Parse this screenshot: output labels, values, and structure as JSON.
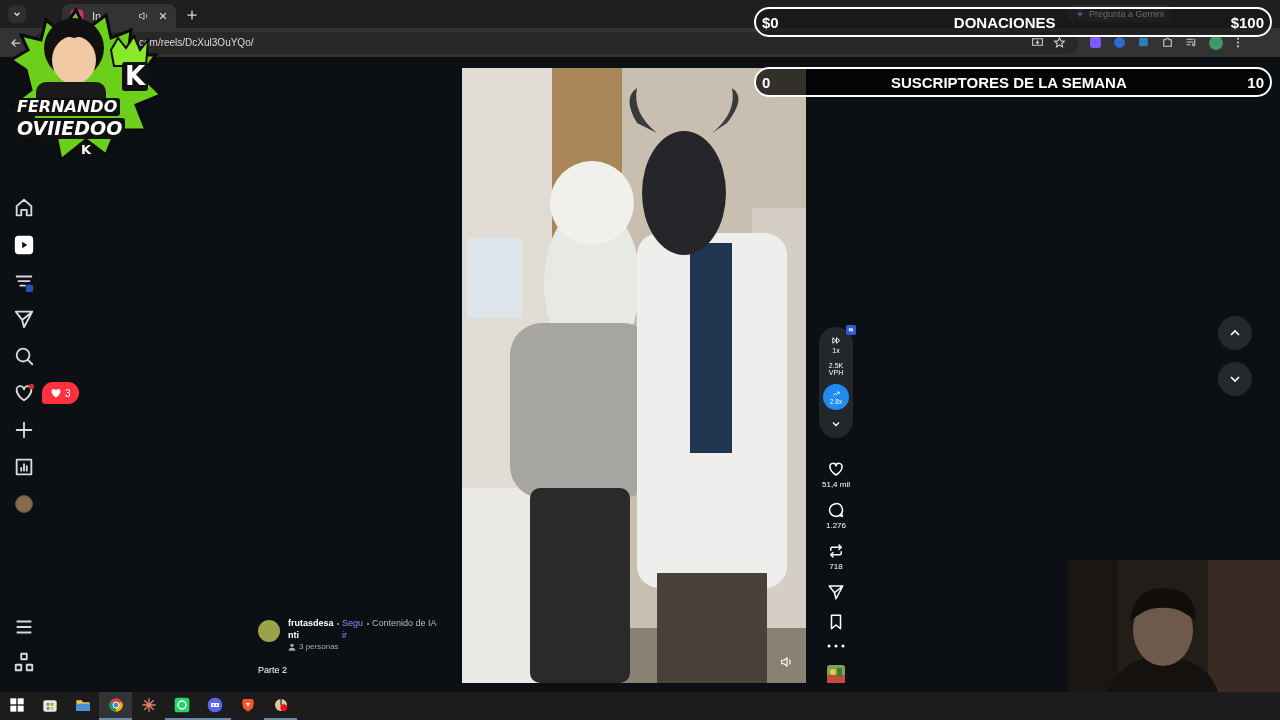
{
  "browser": {
    "tab": {
      "title": "In",
      "audio": true
    },
    "url": "com/reels/DcXul3OuYQo/",
    "gemini": "Pregunta a Gemini"
  },
  "overlay": {
    "logo": {
      "lines": [
        "FERNANDO",
        "OVIIEDOO"
      ],
      "marks": [
        "K",
        "K"
      ]
    },
    "goals": [
      {
        "label": "DONACIONES",
        "start": "$0",
        "end": "$100",
        "level": 0
      },
      {
        "label": "SUSCRIPTORES DE LA SEMANA",
        "start": "0",
        "end": "10",
        "level": 0
      }
    ]
  },
  "sidebar": {
    "items": [
      {
        "kind": "home",
        "selected": false,
        "dot": false
      },
      {
        "kind": "reels",
        "selected": true,
        "dot": false
      },
      {
        "kind": "feed",
        "selected": false,
        "dot": false
      },
      {
        "kind": "send",
        "selected": false,
        "dot": false
      },
      {
        "kind": "search",
        "selected": false,
        "dot": false
      },
      {
        "kind": "heart",
        "selected": false,
        "dot": true
      },
      {
        "kind": "plus",
        "selected": false,
        "dot": false
      },
      {
        "kind": "insights",
        "selected": false,
        "dot": false
      },
      {
        "kind": "avatar",
        "selected": false,
        "dot": false
      }
    ],
    "bottom": [
      {
        "kind": "menu"
      },
      {
        "kind": "apps"
      }
    ],
    "notification_bubble": {
      "count": "3"
    }
  },
  "reel": {
    "author": "frutasdesanti",
    "follow": "Seguir",
    "tag": "Contenido de IA",
    "collaborators": "3 personas",
    "caption": "Parte 2"
  },
  "tools": {
    "speed": "1x",
    "vph": "2.5K",
    "vph_label": "VPH",
    "boost": "2.8x"
  },
  "actions": [
    {
      "kind": "like",
      "count": "51,4 mil"
    },
    {
      "kind": "comment",
      "count": "1.276"
    },
    {
      "kind": "repost",
      "count": "718"
    },
    {
      "kind": "share"
    },
    {
      "kind": "save"
    },
    {
      "kind": "more"
    }
  ],
  "taskbar": [
    {
      "kind": "windows",
      "selected": false,
      "running": false
    },
    {
      "kind": "store",
      "selected": false,
      "running": false
    },
    {
      "kind": "folder",
      "selected": false,
      "running": false
    },
    {
      "kind": "chrome",
      "selected": true,
      "running": true
    },
    {
      "kind": "burst",
      "selected": false,
      "running": false
    },
    {
      "kind": "whatsapp",
      "selected": false,
      "running": true
    },
    {
      "kind": "discord",
      "selected": false,
      "running": true
    },
    {
      "kind": "brave",
      "selected": false,
      "running": false
    },
    {
      "kind": "dial",
      "selected": false,
      "running": true
    }
  ]
}
